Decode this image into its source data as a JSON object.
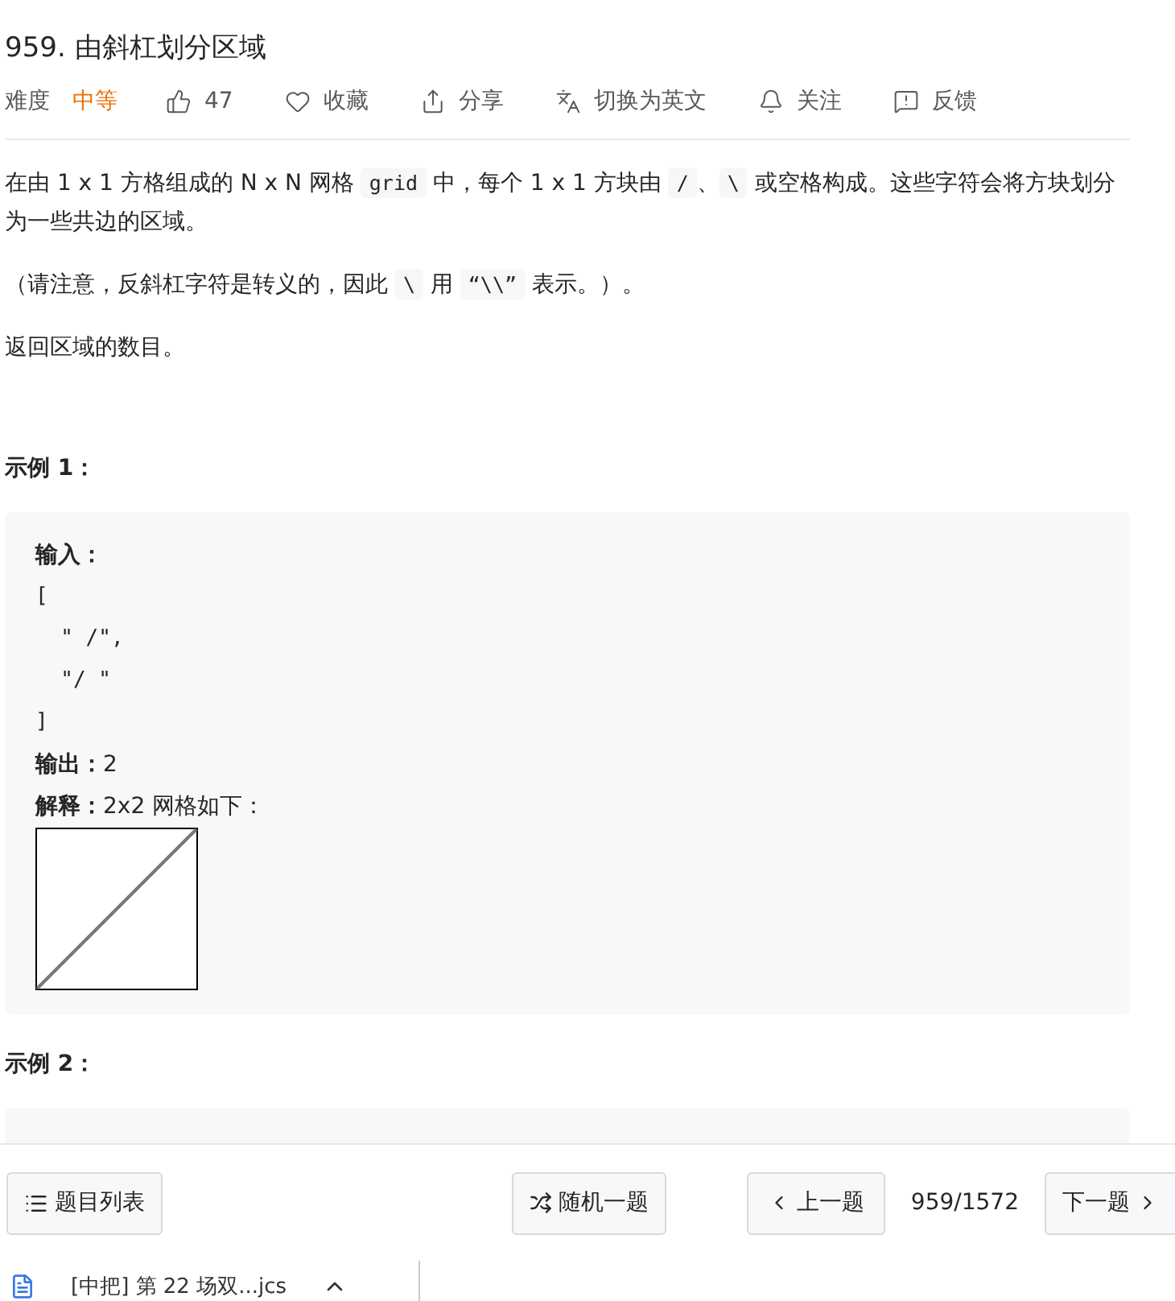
{
  "title": "959. 由斜杠划分区域",
  "meta": {
    "difficulty_label": "难度",
    "difficulty": "中等",
    "actions": [
      "47",
      "收藏",
      "分享",
      "切换为英文",
      "关注",
      "反馈"
    ]
  },
  "paragraphs": [
    [
      {
        "text": "在由 1 x 1 方格组成的 N x N 网格 ",
        "kind": "text"
      },
      {
        "text": "grid",
        "kind": "code"
      },
      {
        "text": " 中，每个 1 x 1 方块由 ",
        "kind": "text"
      },
      {
        "text": "/",
        "kind": "code"
      },
      {
        "text": "、",
        "kind": "text"
      },
      {
        "text": "\\",
        "kind": "code"
      },
      {
        "text": " 或空格构成。这些字符会将方块划分为一些共边的区域。",
        "kind": "text"
      }
    ],
    [
      {
        "text": "（请注意，反斜杠字符是转义的，因此 ",
        "kind": "text"
      },
      {
        "text": "\\",
        "kind": "code"
      },
      {
        "text": " 用 ",
        "kind": "text"
      },
      {
        "text": "“\\\\”",
        "kind": "code"
      },
      {
        "text": " 表示。）。",
        "kind": "text"
      }
    ],
    [
      {
        "text": "返回区域的数目。",
        "kind": "text"
      }
    ]
  ],
  "examples": [
    {
      "heading": "示例 1：",
      "input_label": "输入：",
      "input_lines": [
        "[",
        "  \" /\",",
        "  \"/ \"",
        "]"
      ],
      "output_label": "输出：",
      "output": "2",
      "explain_label": "解释：",
      "explain": "2x2 网格如下："
    },
    {
      "heading": "示例 2："
    }
  ],
  "bottom_bar": {
    "list_button": "题目列表",
    "random_button": "随机一题",
    "prev_button": "上一题",
    "counter": "959/1572",
    "next_button": "下一题"
  },
  "download": {
    "file": "[中把] 第 22 场双...jcs"
  }
}
